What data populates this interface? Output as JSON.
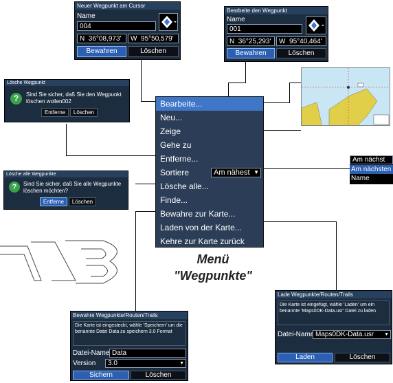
{
  "new_waypoint_dialog": {
    "title": "Neuer Wegpunkt am Cursor",
    "name_label": "Name",
    "name_value": "004",
    "lat_dir": "N",
    "lat_value": "36°08,973'",
    "lon_dir": "W",
    "lon_value": "95°50,579'",
    "save_button": "Bewahren",
    "delete_button": "Löschen"
  },
  "edit_waypoint_dialog": {
    "title": "Bearbeite den Wegpunkt",
    "name_label": "Name",
    "name_value": "001",
    "lat_dir": "N",
    "lat_value": "36°25,293'",
    "lon_dir": "W",
    "lon_value": "95°40,464'",
    "save_button": "Bewahren",
    "delete_button": "Löschen"
  },
  "delete_waypoint_dialog": {
    "title": "Lösche Wegpunkt",
    "message": "Sind Sie sicher, daß Sie den Wegpunkt löschen wollen002",
    "remove_button": "Entferne",
    "delete_button": "Löschen"
  },
  "delete_all_dialog": {
    "title": "Lösche alle Wegpunkte",
    "message": "Sind Sie sicher, daß Sie alle Wegpunkte löschen möchten?",
    "remove_button": "Entferne",
    "delete_button": "Löschen"
  },
  "menu": {
    "items": [
      "Bearbeite...",
      "Neu...",
      "Zeige",
      "Gehe zu",
      "Entferne...",
      "Sortiere",
      "Lösche alle...",
      "Finde...",
      "Bewahre zur Karte...",
      "Laden von der Karte...",
      "Kehre zur Karte zurück"
    ],
    "sort_value": "Am nähest"
  },
  "caption": {
    "line1": "Menü",
    "line2": "\"Wegpunkte\""
  },
  "sort_dropdown": {
    "selected": "Am nächst",
    "options": [
      "Am nächsten",
      "Name"
    ]
  },
  "save_to_card_dialog": {
    "title": "Bewahre Wegpunkte/Routen/Trails",
    "message": "Die Karte ist eingesteckt, wähle 'Speichern' um die benannte Datei Data zu speichern 3.0 Format",
    "filename_label": "Datei-Name",
    "filename_value": "Data",
    "version_label": "Version",
    "version_value": "3.0",
    "save_button": "Sichern",
    "delete_button": "Löschen"
  },
  "load_from_card_dialog": {
    "title": "Lade Wegpunkte/Routen/Trails",
    "message": "Die Karte ist eingefügt, wähle 'Laden' um ein benannte 'Maps0DK-Data.usr' Datei zu laden",
    "filename_label": "Datei-Name",
    "filename_value": "Maps0DK-Data.usr",
    "load_button": "Laden",
    "delete_button": "Löschen"
  },
  "colors": {
    "dialog_bg": "#1d2d40",
    "menu_bg": "#2c3e57",
    "highlight": "#3f76c8",
    "map_water": "#c9e6f5",
    "map_land": "#e1cf4a"
  }
}
